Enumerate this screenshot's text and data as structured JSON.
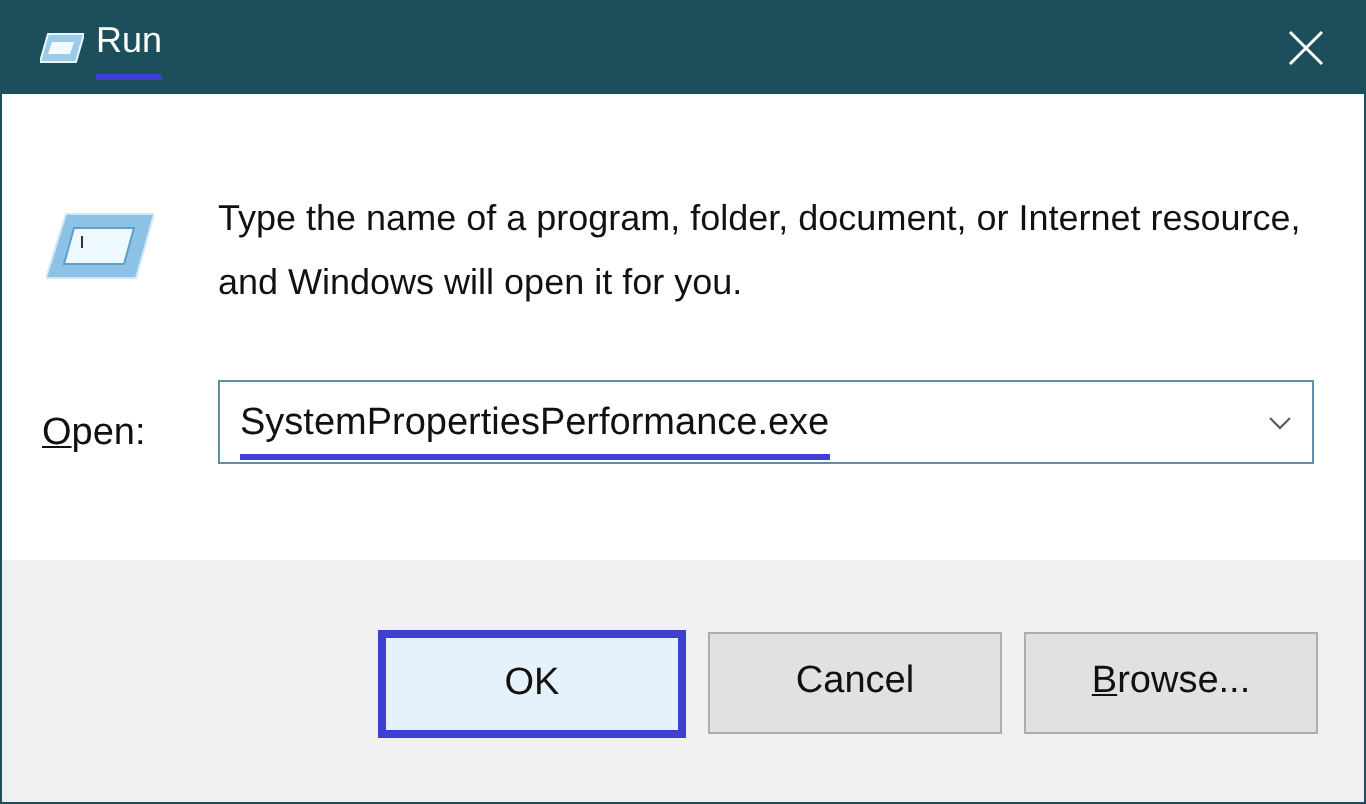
{
  "window": {
    "title": "Run",
    "title_highlighted": true
  },
  "message": "Type the name of a program, folder, document, or Internet resource, and Windows will open it for you.",
  "open_field": {
    "label": "Open:",
    "access_key_underlined": true,
    "value": "SystemPropertiesPerformance.exe",
    "value_highlighted": true
  },
  "buttons": [
    {
      "label": "OK",
      "highlighted": true,
      "access_key_underlined": false
    },
    {
      "label": "Cancel",
      "highlighted": false,
      "access_key_underlined": false
    },
    {
      "label": "Browse...",
      "highlighted": false,
      "access_key_underlined": true
    }
  ]
}
